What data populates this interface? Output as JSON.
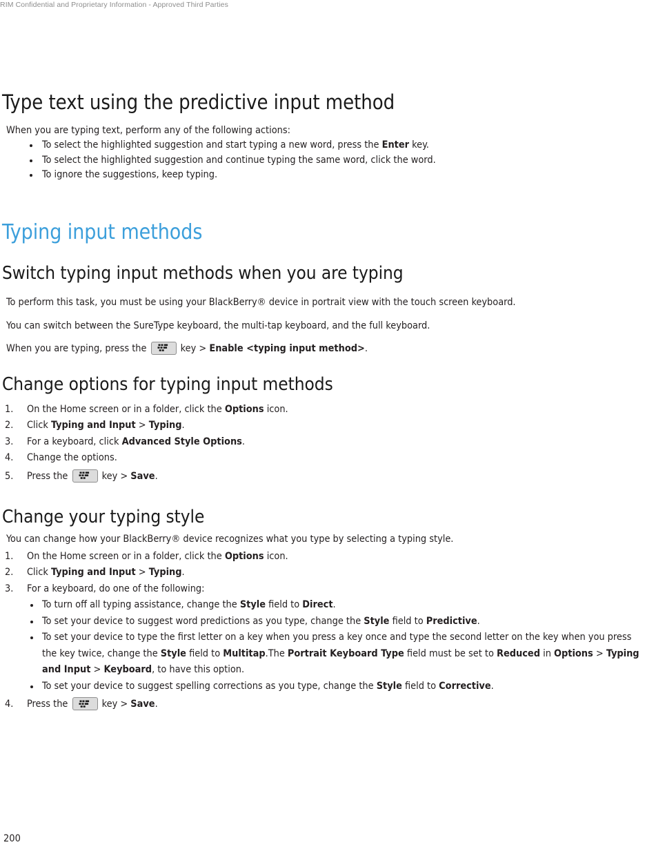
{
  "header": {
    "confidentiality_notice": "RIM Confidential and Proprietary Information - Approved Third Parties"
  },
  "footer": {
    "page_number": "200"
  },
  "colors": {
    "section_heading_blue": "#3c9fdb",
    "body_text": "#231f20",
    "header_text": "#8d8d8d",
    "key_icon_background": "#dcdcdc",
    "key_icon_border": "#8e8e8e"
  },
  "icons": {
    "blackberry_menu_key": "blackberry-menu-key-icon"
  },
  "sections": {
    "predictive": {
      "title": "Type text using the predictive input method",
      "intro": "When you are typing text, perform any of the following actions:",
      "bullets": [
        {
          "before": "To select the highlighted suggestion and start typing a new word, press the ",
          "bold": "Enter",
          "after": " key."
        },
        {
          "before": "To select the highlighted suggestion and continue typing the same word, click the word.",
          "bold": "",
          "after": ""
        },
        {
          "before": "To ignore the suggestions, keep typing.",
          "bold": "",
          "after": ""
        }
      ]
    },
    "typing_input_methods": {
      "title": "Typing input methods"
    },
    "switch_methods": {
      "title": "Switch typing input methods when you are typing",
      "prerequisite": "To perform this task, you must be using your BlackBerry® device in portrait view with the touch screen keyboard.",
      "description": "You can switch between the SureType keyboard, the multi-tap keyboard, and the full keyboard.",
      "instruction_before_key": "When you are typing, press the ",
      "instruction_after_key": " key > ",
      "instruction_bold": "Enable <typing input method>",
      "instruction_end": "."
    },
    "change_options": {
      "title": "Change options for typing input methods",
      "steps": [
        {
          "num": "1.",
          "before": "On the Home screen or in a folder, click the ",
          "bold": "Options",
          "after": " icon."
        },
        {
          "num": "2.",
          "before": "Click ",
          "bold": "Typing and Input",
          "mid": " > ",
          "bold2": "Typing",
          "after": "."
        },
        {
          "num": "3.",
          "before": "For a keyboard, click ",
          "bold": "Advanced Style Options",
          "after": "."
        },
        {
          "num": "4.",
          "before": "Change the options.",
          "bold": "",
          "after": ""
        }
      ],
      "final_step": {
        "num": "5.",
        "before": "Press the ",
        "after_key": " key > ",
        "bold": "Save",
        "end": "."
      }
    },
    "change_style": {
      "title": "Change your typing style",
      "intro": "You can change how your BlackBerry® device recognizes what you type by selecting a typing style.",
      "steps": [
        {
          "num": "1.",
          "before": "On the Home screen or in a folder, click the ",
          "bold": "Options",
          "after": " icon."
        },
        {
          "num": "2.",
          "before": "Click ",
          "bold": "Typing and Input",
          "mid": " > ",
          "bold2": "Typing",
          "after": "."
        },
        {
          "num": "3.",
          "before": "For a keyboard, do one of the following:",
          "bold": "",
          "after": ""
        }
      ],
      "sub_bullets": [
        {
          "p1": "To turn off all typing assistance, change the ",
          "b1": "Style",
          "p2": " field to ",
          "b2": "Direct",
          "p3": "."
        },
        {
          "p1": "To set your device to suggest word predictions as you type, change the ",
          "b1": "Style",
          "p2": " field to ",
          "b2": "Predictive",
          "p3": "."
        },
        {
          "p1": "To set your device to type the first letter on a key when you press a key once and type the second letter on the key when you press the key twice, change the ",
          "b1": "Style",
          "p2": " field to ",
          "b2": "Multitap",
          "p3": ".The ",
          "b3": "Portrait Keyboard Type",
          "p4": " field must be set to ",
          "b4": "Reduced",
          "p5": " in ",
          "b5": "Options",
          "p6": " > ",
          "b6": "Typing and Input",
          "p7": " > ",
          "b7": "Keyboard",
          "p8": ", to have this option."
        },
        {
          "p1": "To set your device to suggest spelling corrections as you type, change the ",
          "b1": "Style",
          "p2": " field to ",
          "b2": "Corrective",
          "p3": "."
        }
      ],
      "final_step": {
        "num": "4.",
        "before": "Press the ",
        "after_key": " key > ",
        "bold": "Save",
        "end": "."
      }
    }
  }
}
